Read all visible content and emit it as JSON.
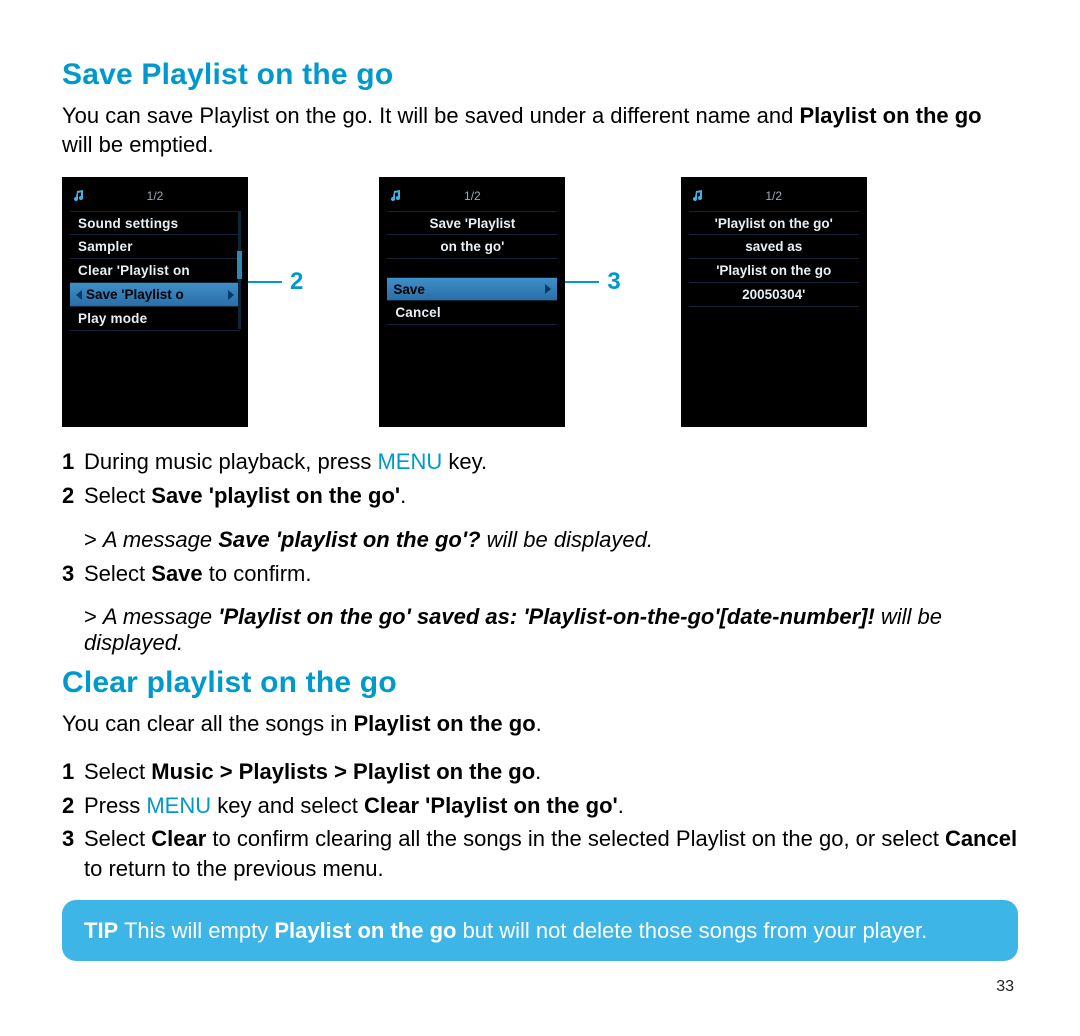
{
  "page_number": "33",
  "sections": {
    "save": {
      "heading": "Save Playlist on the go",
      "intro_pre": "You can save Playlist on the go. It will be saved under a different name and ",
      "intro_bold": "Playlist on the go",
      "intro_post": " will be emptied.",
      "steps": {
        "s1_n": "1",
        "s1_pre": "During music playback, press ",
        "s1_menu": "MENU",
        "s1_post": " key.",
        "s2_n": "2",
        "s2_pre": "Select ",
        "s2_bold": "Save 'playlist on the go'",
        "s2_post": ".",
        "sub1_caret": ">",
        "sub1_pre": "A message ",
        "sub1_bold": "Save 'playlist on the go'?",
        "sub1_post": " will be displayed.",
        "s3_n": "3",
        "s3_pre": "Select ",
        "s3_bold": "Save",
        "s3_post": " to confirm.",
        "sub2_caret": ">",
        "sub2_pre": "A message ",
        "sub2_bold": "'Playlist on the go' saved as: 'Playlist-on-the-go'[date-number]!",
        "sub2_post": " will be displayed."
      }
    },
    "clear": {
      "heading": "Clear playlist on the go",
      "intro_pre": "You can clear all the songs in ",
      "intro_bold": "Playlist on the go",
      "intro_post": ".",
      "steps": {
        "s1_n": "1",
        "s1_pre": "Select ",
        "s1_bold": "Music > Playlists > Playlist on the go",
        "s1_post": ".",
        "s2_n": "2",
        "s2_pre": "Press ",
        "s2_menu": "MENU",
        "s2_mid": " key and select ",
        "s2_bold": "Clear 'Playlist on the go'",
        "s2_post": ".",
        "s3_n": "3",
        "s3_pre": "Select ",
        "s3_bold1": "Clear",
        "s3_mid": " to confirm clearing all the songs in the selected Playlist on the go, or select ",
        "s3_bold2": "Cancel",
        "s3_post": " to return to the previous menu."
      }
    }
  },
  "tip": {
    "label": "TIP",
    "pre": " This will empty ",
    "bold": "Playlist on the go",
    "post": " but will not delete those songs from your player."
  },
  "callouts": {
    "c2": "2",
    "c3": "3"
  },
  "devices": {
    "d1": {
      "counter": "1/2",
      "items": [
        "Sound settings",
        "Sampler",
        "Clear 'Playlist on"
      ],
      "selected": "Save 'Playlist o",
      "after": [
        "Play mode"
      ]
    },
    "d2": {
      "counter": "1/2",
      "lines": [
        "Save 'Playlist",
        "on the go'"
      ],
      "selected": "Save",
      "after": [
        "Cancel"
      ]
    },
    "d3": {
      "counter": "1/2",
      "lines": [
        "'Playlist on the go'",
        "saved as",
        "'Playlist on the go",
        "20050304'"
      ]
    }
  }
}
